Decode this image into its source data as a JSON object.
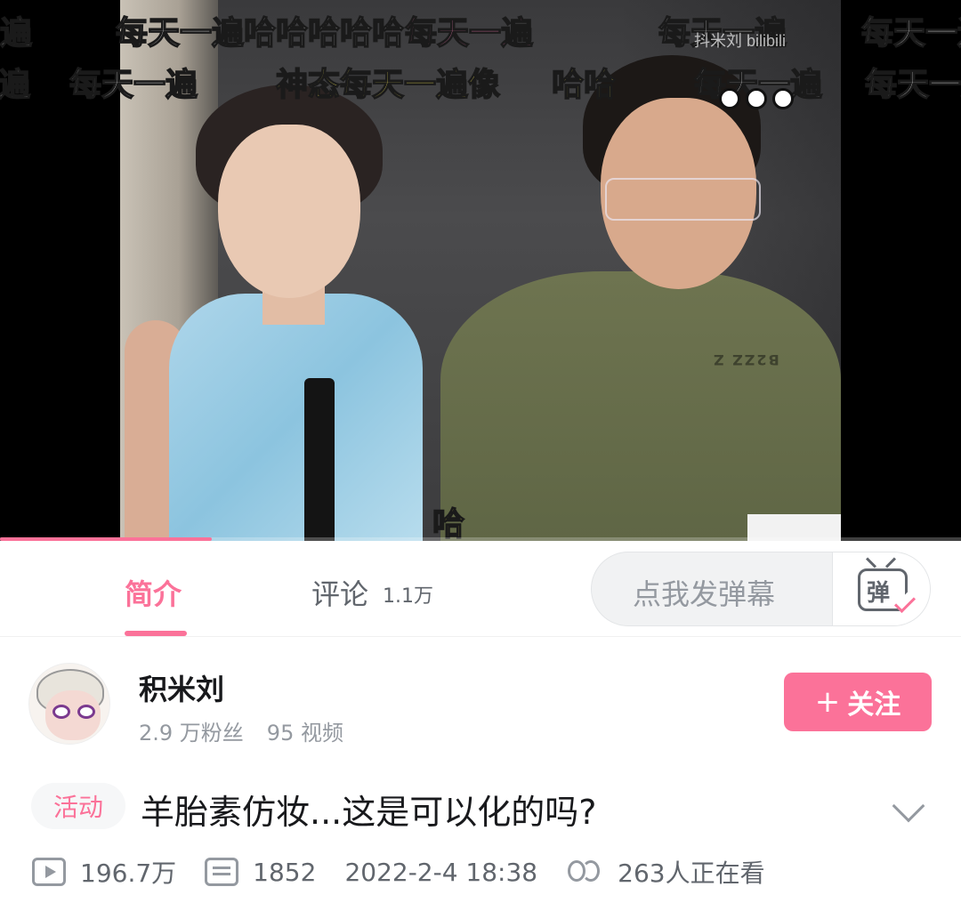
{
  "player": {
    "watermark": "抖米刘 bilibili",
    "progress_fraction": 0.22,
    "shirt_print": "B2ZZ Z",
    "danmaku": [
      {
        "text": "每天一遍哈哈哈哈哈",
        "color": "white"
      },
      {
        "text": "每天一遍",
        "color": "pink"
      },
      {
        "text": "每天一遍",
        "color": "white"
      },
      {
        "text": "每天一遍",
        "color": "white"
      },
      {
        "text": "每天一遍",
        "color": "white"
      },
      {
        "text": "遍",
        "color": "white"
      },
      {
        "text": "每天一遍",
        "color": "white"
      },
      {
        "text": "神态每天一遍像",
        "color": "yellow"
      },
      {
        "text": "哈哈",
        "color": "yellow"
      },
      {
        "text": "每天一遍",
        "color": "white"
      },
      {
        "text": "每天一遍",
        "color": "white"
      },
      {
        "text": "哈",
        "color": "yellow"
      }
    ]
  },
  "tabs": {
    "intro_label": "简介",
    "comments_label": "评论",
    "comments_count": "1.1万"
  },
  "danmaku_input": {
    "placeholder": "点我发弹幕",
    "send_icon_char": "弹"
  },
  "uploader": {
    "name": "积米刘",
    "followers": "2.9 万粉丝",
    "videos": "95 视频",
    "follow_label": "关注",
    "follow_plus": "+"
  },
  "video": {
    "tag": "活动",
    "title": "羊胎素仿妆...这是可以化的吗?",
    "views": "196.7万",
    "danmaku_count": "1852",
    "publish_time": "2022-2-4 18:38",
    "watching": "263人正在看"
  },
  "colors": {
    "accent": "#fb7299",
    "text_primary": "#18191c",
    "text_secondary": "#61666d",
    "text_muted": "#9499a0"
  }
}
